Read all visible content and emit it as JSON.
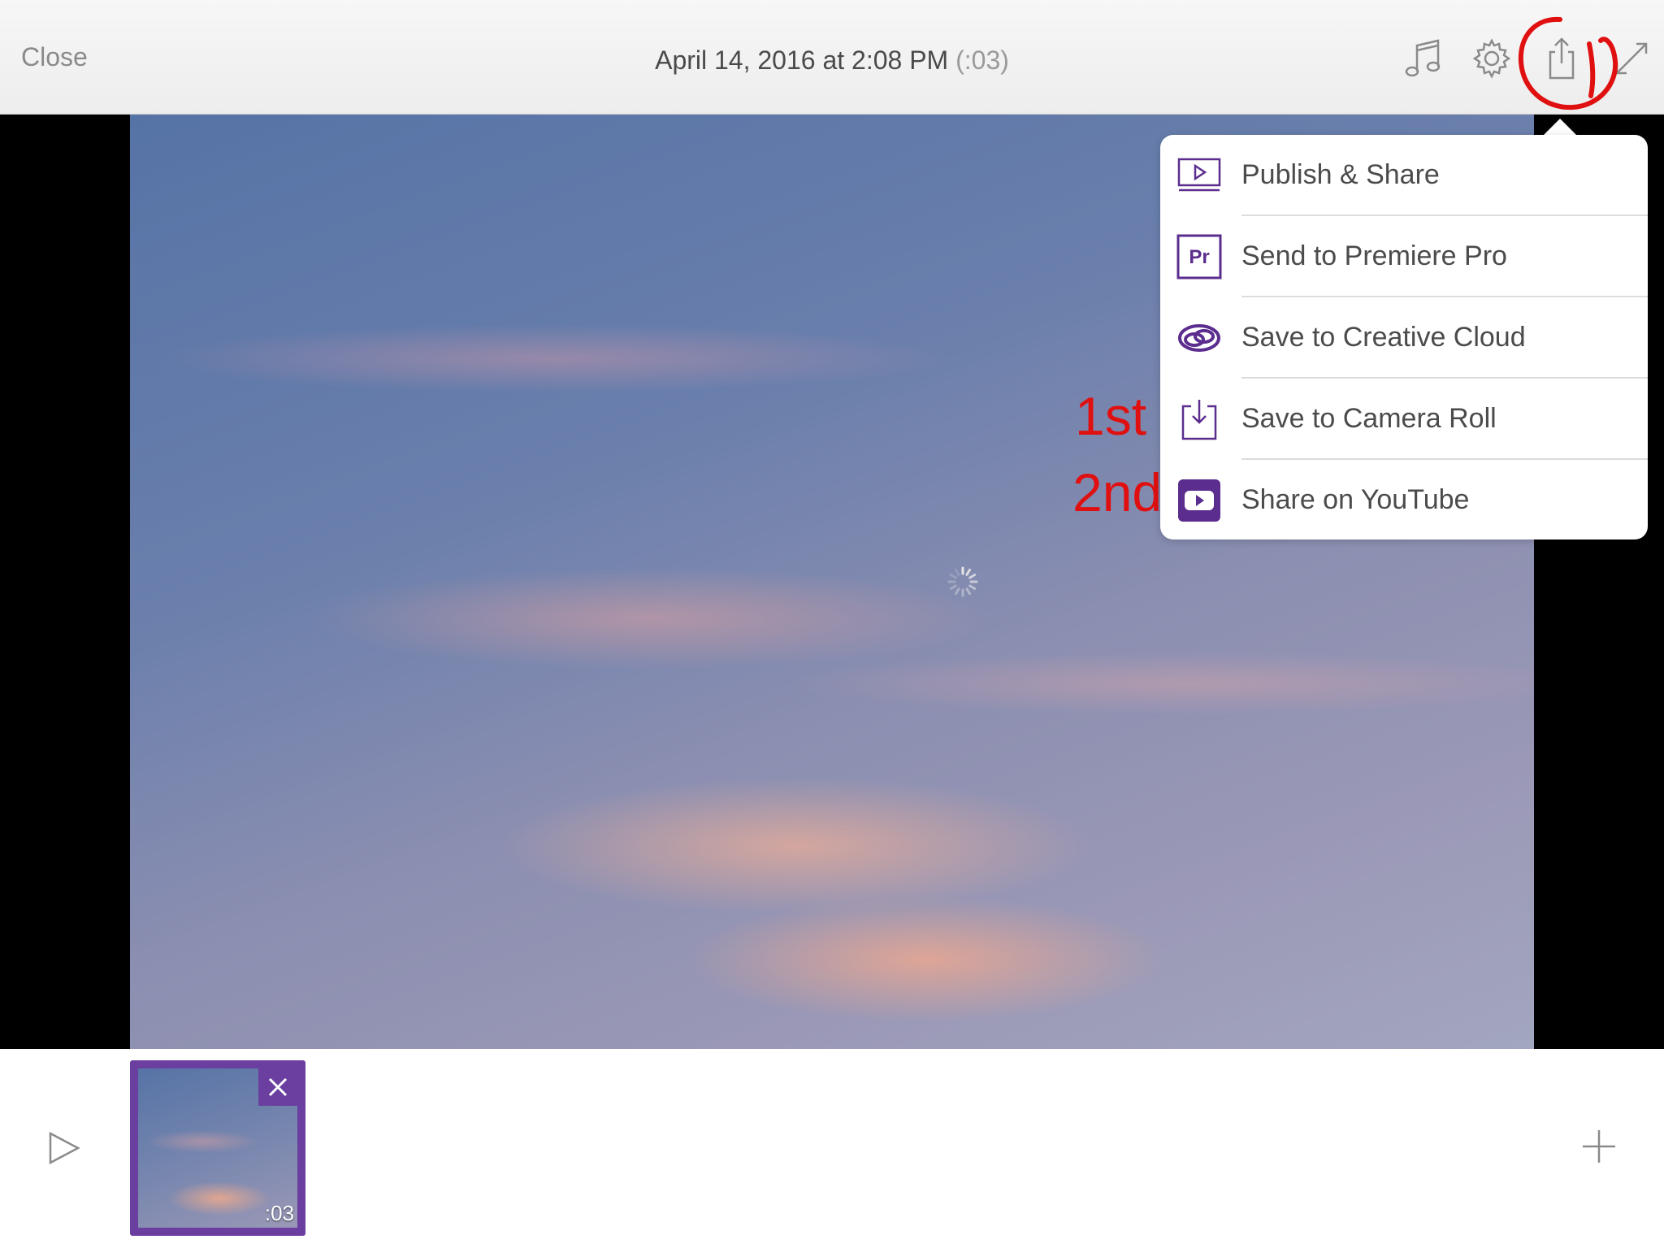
{
  "topbar": {
    "close_label": "Close",
    "title": "April 14, 2016 at 2:08 PM",
    "title_duration": "(:03)",
    "icons": [
      "music-icon",
      "gear-icon",
      "share-icon",
      "expand-icon"
    ]
  },
  "player": {
    "loading": true
  },
  "share_menu": {
    "items": [
      {
        "label": "Publish & Share",
        "icon": "publish-share-icon"
      },
      {
        "label": "Send to Premiere Pro",
        "icon": "premiere-pro-icon"
      },
      {
        "label": "Save to Creative Cloud",
        "icon": "creative-cloud-icon"
      },
      {
        "label": "Save to Camera Roll",
        "icon": "camera-roll-download-icon"
      },
      {
        "label": "Share on YouTube",
        "icon": "youtube-icon"
      }
    ]
  },
  "annotations": {
    "first": "1st",
    "second": "2nd",
    "color": "#e01010"
  },
  "timeline": {
    "clip_duration": ":03",
    "accent_color": "#6a3fa0"
  },
  "colors": {
    "accent": "#6a3fa0",
    "menu_icon": "#5b2d8e"
  }
}
